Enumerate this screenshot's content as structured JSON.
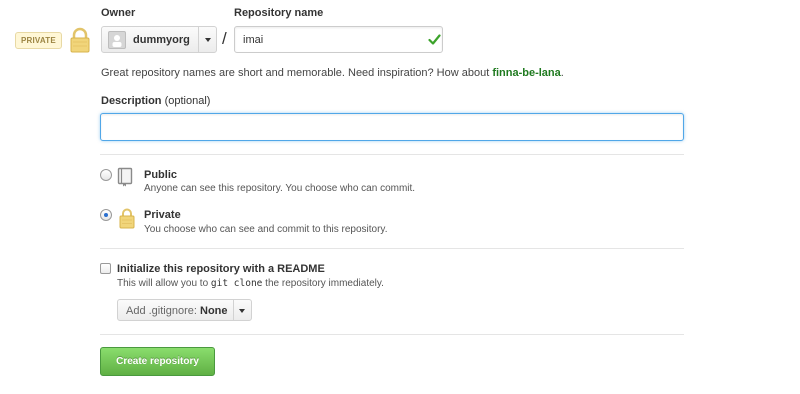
{
  "badge": {
    "text": "PRIVATE",
    "icon": "lock-icon"
  },
  "owner": {
    "label": "Owner",
    "value": "dummyorg",
    "avatar_icon": "organization-avatar",
    "caret_icon": "caret-down-icon"
  },
  "separator": "/",
  "repo": {
    "label": "Repository name",
    "value": "imai",
    "valid_icon": "check-icon"
  },
  "hint": {
    "text": "Great repository names are short and memorable. Need inspiration? How about ",
    "suggestion": "finna-be-lana",
    "suffix": "."
  },
  "description": {
    "label": "Description",
    "optional": "(optional)",
    "value": ""
  },
  "visibility": {
    "public": {
      "title": "Public",
      "description": "Anyone can see this repository. You choose who can commit.",
      "icon": "repo-book-icon",
      "checked": false
    },
    "private": {
      "title": "Private",
      "description": "You choose who can see and commit to this repository.",
      "icon": "lock-icon",
      "checked": true
    }
  },
  "readme": {
    "title": "Initialize this repository with a README",
    "desc_before": "This will allow you to ",
    "desc_code": "git clone",
    "desc_after": " the repository immediately.",
    "checked": false
  },
  "gitignore": {
    "label": "Add .gitignore:",
    "value": "None"
  },
  "submit": {
    "label": "Create repository"
  },
  "colors": {
    "accent": "#51a7e8",
    "success": "#60b044",
    "suggestion": "#1f7a1f",
    "badge_bg": "#fff7d6"
  }
}
